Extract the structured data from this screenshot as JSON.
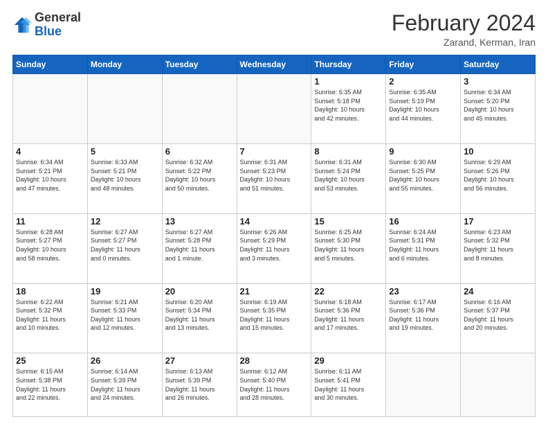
{
  "header": {
    "logo": {
      "general": "General",
      "blue": "Blue"
    },
    "title": "February 2024",
    "location": "Zarand, Kerman, Iran"
  },
  "days_of_week": [
    "Sunday",
    "Monday",
    "Tuesday",
    "Wednesday",
    "Thursday",
    "Friday",
    "Saturday"
  ],
  "weeks": [
    [
      {
        "day": "",
        "info": ""
      },
      {
        "day": "",
        "info": ""
      },
      {
        "day": "",
        "info": ""
      },
      {
        "day": "",
        "info": ""
      },
      {
        "day": "1",
        "info": "Sunrise: 6:35 AM\nSunset: 5:18 PM\nDaylight: 10 hours\nand 42 minutes."
      },
      {
        "day": "2",
        "info": "Sunrise: 6:35 AM\nSunset: 5:19 PM\nDaylight: 10 hours\nand 44 minutes."
      },
      {
        "day": "3",
        "info": "Sunrise: 6:34 AM\nSunset: 5:20 PM\nDaylight: 10 hours\nand 45 minutes."
      }
    ],
    [
      {
        "day": "4",
        "info": "Sunrise: 6:34 AM\nSunset: 5:21 PM\nDaylight: 10 hours\nand 47 minutes."
      },
      {
        "day": "5",
        "info": "Sunrise: 6:33 AM\nSunset: 5:21 PM\nDaylight: 10 hours\nand 48 minutes."
      },
      {
        "day": "6",
        "info": "Sunrise: 6:32 AM\nSunset: 5:22 PM\nDaylight: 10 hours\nand 50 minutes."
      },
      {
        "day": "7",
        "info": "Sunrise: 6:31 AM\nSunset: 5:23 PM\nDaylight: 10 hours\nand 51 minutes."
      },
      {
        "day": "8",
        "info": "Sunrise: 6:31 AM\nSunset: 5:24 PM\nDaylight: 10 hours\nand 53 minutes."
      },
      {
        "day": "9",
        "info": "Sunrise: 6:30 AM\nSunset: 5:25 PM\nDaylight: 10 hours\nand 55 minutes."
      },
      {
        "day": "10",
        "info": "Sunrise: 6:29 AM\nSunset: 5:26 PM\nDaylight: 10 hours\nand 56 minutes."
      }
    ],
    [
      {
        "day": "11",
        "info": "Sunrise: 6:28 AM\nSunset: 5:27 PM\nDaylight: 10 hours\nand 58 minutes."
      },
      {
        "day": "12",
        "info": "Sunrise: 6:27 AM\nSunset: 5:27 PM\nDaylight: 11 hours\nand 0 minutes."
      },
      {
        "day": "13",
        "info": "Sunrise: 6:27 AM\nSunset: 5:28 PM\nDaylight: 11 hours\nand 1 minute."
      },
      {
        "day": "14",
        "info": "Sunrise: 6:26 AM\nSunset: 5:29 PM\nDaylight: 11 hours\nand 3 minutes."
      },
      {
        "day": "15",
        "info": "Sunrise: 6:25 AM\nSunset: 5:30 PM\nDaylight: 11 hours\nand 5 minutes."
      },
      {
        "day": "16",
        "info": "Sunrise: 6:24 AM\nSunset: 5:31 PM\nDaylight: 11 hours\nand 6 minutes."
      },
      {
        "day": "17",
        "info": "Sunrise: 6:23 AM\nSunset: 5:32 PM\nDaylight: 11 hours\nand 8 minutes."
      }
    ],
    [
      {
        "day": "18",
        "info": "Sunrise: 6:22 AM\nSunset: 5:32 PM\nDaylight: 11 hours\nand 10 minutes."
      },
      {
        "day": "19",
        "info": "Sunrise: 6:21 AM\nSunset: 5:33 PM\nDaylight: 11 hours\nand 12 minutes."
      },
      {
        "day": "20",
        "info": "Sunrise: 6:20 AM\nSunset: 5:34 PM\nDaylight: 11 hours\nand 13 minutes."
      },
      {
        "day": "21",
        "info": "Sunrise: 6:19 AM\nSunset: 5:35 PM\nDaylight: 11 hours\nand 15 minutes."
      },
      {
        "day": "22",
        "info": "Sunrise: 6:18 AM\nSunset: 5:36 PM\nDaylight: 11 hours\nand 17 minutes."
      },
      {
        "day": "23",
        "info": "Sunrise: 6:17 AM\nSunset: 5:36 PM\nDaylight: 11 hours\nand 19 minutes."
      },
      {
        "day": "24",
        "info": "Sunrise: 6:16 AM\nSunset: 5:37 PM\nDaylight: 11 hours\nand 20 minutes."
      }
    ],
    [
      {
        "day": "25",
        "info": "Sunrise: 6:15 AM\nSunset: 5:38 PM\nDaylight: 11 hours\nand 22 minutes."
      },
      {
        "day": "26",
        "info": "Sunrise: 6:14 AM\nSunset: 5:39 PM\nDaylight: 11 hours\nand 24 minutes."
      },
      {
        "day": "27",
        "info": "Sunrise: 6:13 AM\nSunset: 5:39 PM\nDaylight: 11 hours\nand 26 minutes."
      },
      {
        "day": "28",
        "info": "Sunrise: 6:12 AM\nSunset: 5:40 PM\nDaylight: 11 hours\nand 28 minutes."
      },
      {
        "day": "29",
        "info": "Sunrise: 6:11 AM\nSunset: 5:41 PM\nDaylight: 11 hours\nand 30 minutes."
      },
      {
        "day": "",
        "info": ""
      },
      {
        "day": "",
        "info": ""
      }
    ]
  ]
}
